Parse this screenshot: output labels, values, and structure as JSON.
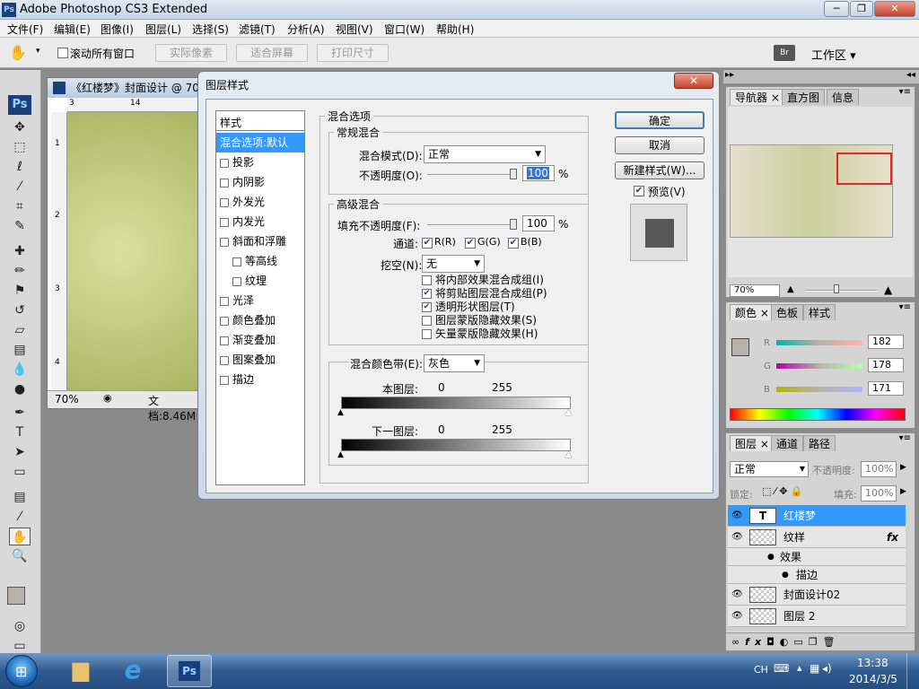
{
  "app": {
    "title": "Adobe Photoshop CS3 Extended",
    "icon_text": "Ps"
  },
  "menus": [
    "文件(F)",
    "编辑(E)",
    "图像(I)",
    "图层(L)",
    "选择(S)",
    "滤镜(T)",
    "分析(A)",
    "视图(V)",
    "窗口(W)",
    "帮助(H)"
  ],
  "optbar": {
    "scroll_all": "滚动所有窗口",
    "actual_pixels": "实际像素",
    "fit_screen": "适合屏幕",
    "print_size": "打印尺寸",
    "workspace": "工作区 ▾"
  },
  "document": {
    "title": "《红楼梦》封面设计 @ 70",
    "zoom": "70%",
    "doc_info": "文档:8.46M",
    "ruler_ticks": [
      "3",
      "14"
    ],
    "side_ticks": [
      "1",
      "2",
      "3",
      "4"
    ]
  },
  "dialog": {
    "title": "图层样式",
    "close": "✕",
    "styles_header": "样式",
    "styles": [
      {
        "label": "混合选项:默认",
        "checkbox": false,
        "selected": true
      },
      {
        "label": "投影",
        "checkbox": true
      },
      {
        "label": "内阴影",
        "checkbox": true
      },
      {
        "label": "外发光",
        "checkbox": true
      },
      {
        "label": "内发光",
        "checkbox": true
      },
      {
        "label": "斜面和浮雕",
        "checkbox": true
      },
      {
        "label": "等高线",
        "checkbox": true,
        "indent": true
      },
      {
        "label": "纹理",
        "checkbox": true,
        "indent": true
      },
      {
        "label": "光泽",
        "checkbox": true
      },
      {
        "label": "颜色叠加",
        "checkbox": true
      },
      {
        "label": "渐变叠加",
        "checkbox": true
      },
      {
        "label": "图案叠加",
        "checkbox": true
      },
      {
        "label": "描边",
        "checkbox": true
      }
    ],
    "blend_options": "混合选项",
    "general": "常规混合",
    "blend_mode_label": "混合模式(D):",
    "blend_mode": "正常",
    "opacity_label": "不透明度(O):",
    "opacity": "100",
    "percent": "%",
    "advanced": "高级混合",
    "fill_opacity_label": "填充不透明度(F):",
    "fill_opacity": "100",
    "channels_label": "通道:",
    "channels": [
      "R(R)",
      "G(G)",
      "B(B)"
    ],
    "knockout_label": "挖空(N):",
    "knockout": "无",
    "adv_options": [
      {
        "label": "将内部效果混合成组(I)",
        "checked": false
      },
      {
        "label": "将剪贴图层混合成组(P)",
        "checked": true
      },
      {
        "label": "透明形状图层(T)",
        "checked": true
      },
      {
        "label": "图层蒙版隐藏效果(S)",
        "checked": false
      },
      {
        "label": "矢量蒙版隐藏效果(H)",
        "checked": false
      }
    ],
    "blend_if_label": "混合颜色带(E):",
    "blend_if": "灰色",
    "this_layer": "本图层:",
    "underlying": "下一图层:",
    "min": "0",
    "max": "255",
    "ok": "确定",
    "cancel": "取消",
    "new_style": "新建样式(W)...",
    "preview": "预览(V)"
  },
  "navigator": {
    "tabs": [
      "导航器",
      "直方图",
      "信息"
    ],
    "zoom": "70%"
  },
  "color": {
    "tabs": [
      "颜色",
      "色板",
      "样式"
    ],
    "r_label": "R",
    "g_label": "G",
    "b_label": "B",
    "r": "182",
    "g": "178",
    "b": "171"
  },
  "layers": {
    "tabs": [
      "图层",
      "通道",
      "路径"
    ],
    "mode": "正常",
    "opacity_label": "不透明度:",
    "opacity": "100%",
    "lock_label": "锁定:",
    "fill_label": "填充:",
    "fill": "100%",
    "items": [
      {
        "name": "红楼梦",
        "type": "text",
        "selected": true
      },
      {
        "name": "纹样",
        "type": "fx"
      },
      {
        "name": "效果",
        "type": "effect"
      },
      {
        "name": "描边",
        "type": "effect-sub"
      },
      {
        "name": "封面设计02",
        "type": "image"
      },
      {
        "name": "图层 2",
        "type": "image"
      }
    ],
    "fx": "fx"
  },
  "taskbar": {
    "lang": "CH",
    "time": "13:38",
    "date": "2014/3/5"
  }
}
